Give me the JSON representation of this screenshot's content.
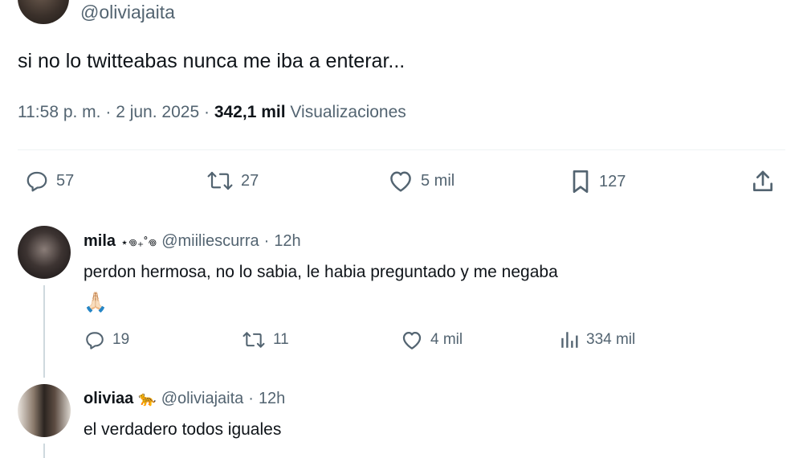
{
  "main_tweet": {
    "handle": "@oliviajaita",
    "text": "si no lo twitteabas nunca me iba a enterar...",
    "time": "11:58 p. m.",
    "date": "2 jun. 2025",
    "views_count": "342,1 mil",
    "views_label": "Visualizaciones",
    "separator": "·",
    "actions": {
      "replies": "57",
      "retweets": "27",
      "likes": "5 mil",
      "bookmarks": "127"
    }
  },
  "replies": [
    {
      "name": "mila",
      "name_decor": "⋆𖦹₊˚𖦹",
      "handle": "@miiliescurra",
      "time": "12h",
      "text": "perdon hermosa, no lo sabia, le habia preguntado y me negaba",
      "emoji": "🙏🏻",
      "actions": {
        "replies": "19",
        "retweets": "11",
        "likes": "4 mil",
        "views": "334 mil"
      }
    },
    {
      "name": "oliviaa",
      "name_decor": "🐆",
      "handle": "@oliviajaita",
      "time": "12h",
      "text": "el verdadero todos iguales"
    }
  ],
  "colors": {
    "text": "#0f1419",
    "secondary": "#536471",
    "divider": "#eff3f4",
    "thread": "#cfd9de"
  }
}
